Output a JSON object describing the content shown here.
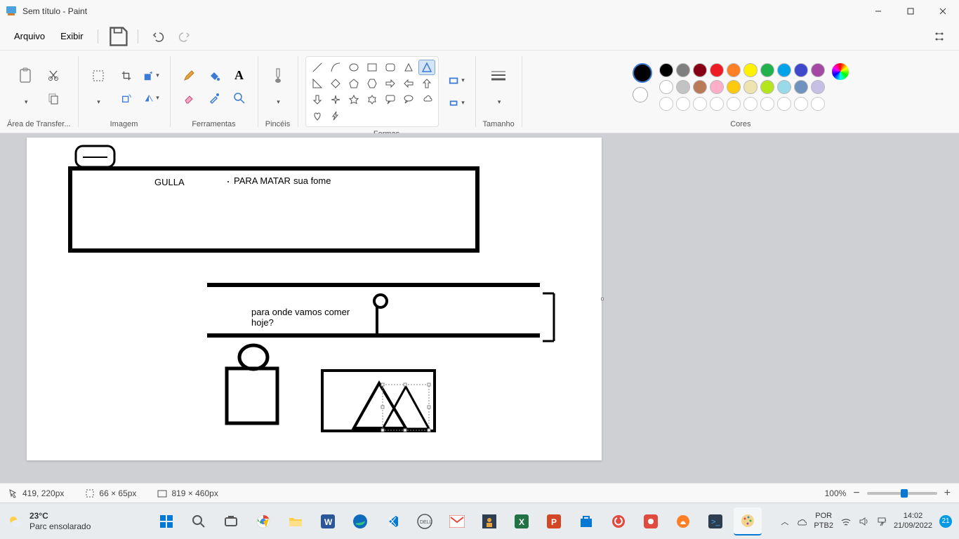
{
  "title": "Sem título - Paint",
  "menu": {
    "file": "Arquivo",
    "view": "Exibir"
  },
  "ribbon": {
    "clipboard": "Área de Transfer...",
    "image": "Imagem",
    "tools": "Ferramentas",
    "brushes": "Pincéis",
    "shapes": "Formas",
    "size": "Tamanho",
    "colors": "Cores"
  },
  "status": {
    "pos": "419, 220px",
    "sel": "66 × 65px",
    "size": "819 × 460px",
    "zoom": "100%"
  },
  "palette_colors": [
    "#000000",
    "#7f7f7f",
    "#880015",
    "#ed1c24",
    "#ff7f27",
    "#fff200",
    "#22b14c",
    "#00a2e8",
    "#3f48cc",
    "#a349a4",
    "#ffffff",
    "#c3c3c3",
    "#b97a57",
    "#ffaec9",
    "#ffc90e",
    "#efe4b0",
    "#b5e61d",
    "#99d9ea",
    "#7092be",
    "#c8bfe7"
  ],
  "current_color1": "#000000",
  "canvas_text": {
    "gulla": "GULLA",
    "paramatar": "PARA MATAR",
    "suafome": "sua fome",
    "pergunta": "para onde vamos comer hoje?"
  },
  "taskbar": {
    "temp": "23°C",
    "weather": "Parc ensolarado",
    "lang1": "POR",
    "lang2": "PTB2",
    "time": "14:02",
    "date": "21/09/2022",
    "badge": "21"
  }
}
